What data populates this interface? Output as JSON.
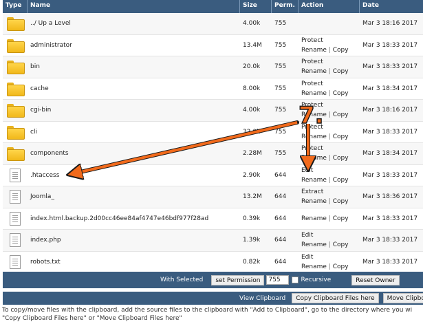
{
  "table": {
    "headers": {
      "type": "Type",
      "name": "Name",
      "size": "Size",
      "perm": "Perm.",
      "action": "Action",
      "date": "Date"
    },
    "rows": [
      {
        "icon": "folder-icon",
        "name": "../ Up a Level",
        "size": "4.00k",
        "perm": "755",
        "actions": [],
        "date": "Mar 3 18:16 2017"
      },
      {
        "icon": "folder-icon",
        "name": "administrator",
        "size": "13.4M",
        "perm": "755",
        "actions": [
          [
            "Protect"
          ],
          [
            "Rename",
            "Copy"
          ]
        ],
        "date": "Mar 3 18:33 2017"
      },
      {
        "icon": "folder-icon",
        "name": "bin",
        "size": "20.0k",
        "perm": "755",
        "actions": [
          [
            "Protect"
          ],
          [
            "Rename",
            "Copy"
          ]
        ],
        "date": "Mar 3 18:33 2017"
      },
      {
        "icon": "folder-icon",
        "name": "cache",
        "size": "8.00k",
        "perm": "755",
        "actions": [
          [
            "Protect"
          ],
          [
            "Rename",
            "Copy"
          ]
        ],
        "date": "Mar 3 18:34 2017"
      },
      {
        "icon": "folder-icon",
        "name": "cgi-bin",
        "size": "4.00k",
        "perm": "755",
        "actions": [
          [
            "Protect"
          ],
          [
            "Rename",
            "Copy"
          ]
        ],
        "date": "Mar 3 18:16 2017"
      },
      {
        "icon": "folder-icon",
        "name": "cli",
        "size": "32.0k",
        "perm": "755",
        "actions": [
          [
            "Protect"
          ],
          [
            "Rename",
            "Copy"
          ]
        ],
        "date": "Mar 3 18:33 2017"
      },
      {
        "icon": "folder-icon",
        "name": "components",
        "size": "2.28M",
        "perm": "755",
        "actions": [
          [
            "Protect"
          ],
          [
            "Rename",
            "Copy"
          ]
        ],
        "date": "Mar 3 18:34 2017"
      },
      {
        "icon": "file-icon",
        "name": ".htaccess",
        "size": "2.90k",
        "perm": "644",
        "actions": [
          [
            "Edit"
          ],
          [
            "Rename",
            "Copy"
          ]
        ],
        "date": "Mar 3 18:33 2017"
      },
      {
        "icon": "file-icon",
        "name": "Joomla_",
        "size": "13.2M",
        "perm": "644",
        "actions": [
          [
            "Extract"
          ],
          [
            "Rename",
            "Copy"
          ]
        ],
        "date": "Mar 3 18:36 2017"
      },
      {
        "icon": "file-icon",
        "name": "index.html.backup.2d00cc46ee84af4747e46bdf977f28ad",
        "size": "0.39k",
        "perm": "644",
        "actions": [
          [
            "Rename",
            "Copy"
          ]
        ],
        "date": "Mar 3 18:33 2017"
      },
      {
        "icon": "file-icon",
        "name": "index.php",
        "size": "1.39k",
        "perm": "644",
        "actions": [
          [
            "Edit"
          ],
          [
            "Rename",
            "Copy"
          ]
        ],
        "date": "Mar 3 18:33 2017"
      },
      {
        "icon": "file-icon",
        "name": "robots.txt",
        "size": "0.82k",
        "perm": "644",
        "actions": [
          [
            "Edit"
          ],
          [
            "Rename",
            "Copy"
          ]
        ],
        "date": "Mar 3 18:33 2017"
      }
    ]
  },
  "selected_bar": {
    "label": "With Selected",
    "set_permission": "set Permission",
    "permission_value": "755",
    "recursive": "Recursive",
    "reset_owner": "Reset Owner"
  },
  "clipboard_bar": {
    "view": "View Clipboard",
    "copy_here": "Copy Clipboard Files here",
    "move_here": "Move Clipbo"
  },
  "help": {
    "line1": "To copy/move files with the clipboard, add the source files to the clipboard with \"Add to Clipboard\", go to the directory where you wi",
    "line2": "\"Copy Clipboard Files here\" or \"Move Clipboard Files here\""
  },
  "annotation": {
    "step": "7.",
    "color": "#f26a1b"
  },
  "colors": {
    "header": "#3a5c7f",
    "folder": "#f1b81a"
  }
}
